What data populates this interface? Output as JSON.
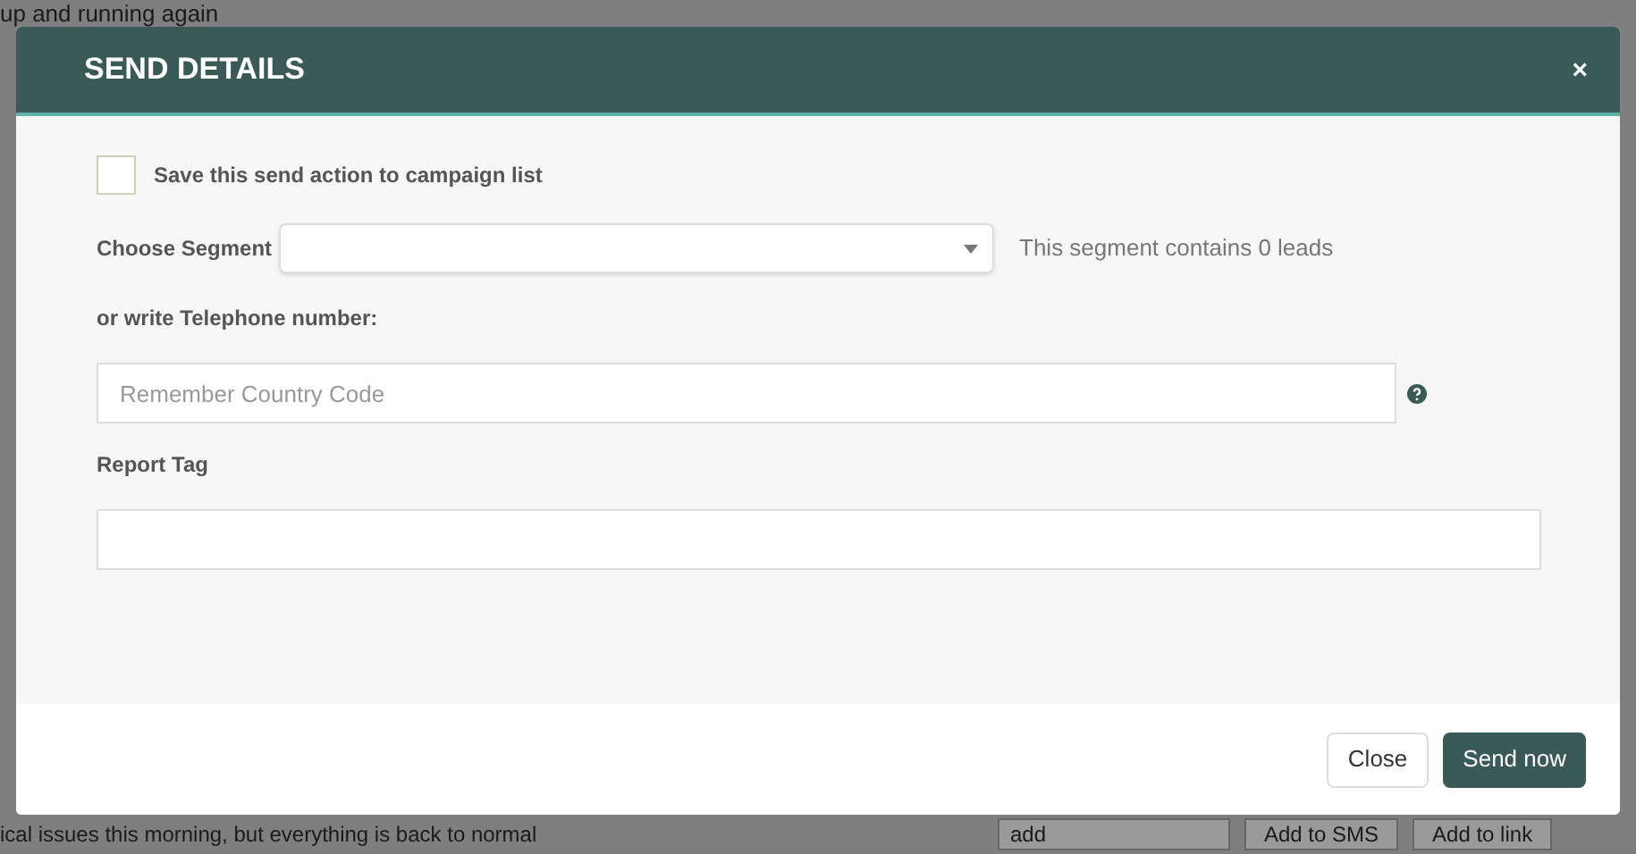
{
  "background": {
    "top_text": "up and running again",
    "bottom_text": "ical issues this morning, but everything is back to normal",
    "dropdown_value": "add",
    "buttons": [
      "Add to SMS",
      "Add to link"
    ]
  },
  "modal": {
    "title": "SEND DETAILS",
    "close_glyph": "×",
    "save_checkbox": {
      "label": "Save this send action to campaign list",
      "checked": false
    },
    "segment": {
      "label": "Choose Segment",
      "info": "This segment contains 0 leads"
    },
    "telephone": {
      "label": "or write Telephone number:",
      "placeholder": "Remember Country Code"
    },
    "report_tag": {
      "label": "Report Tag"
    },
    "buttons": [
      {
        "label": "Close",
        "kind": "secondary"
      },
      {
        "label": "Send now",
        "kind": "primary"
      }
    ]
  }
}
